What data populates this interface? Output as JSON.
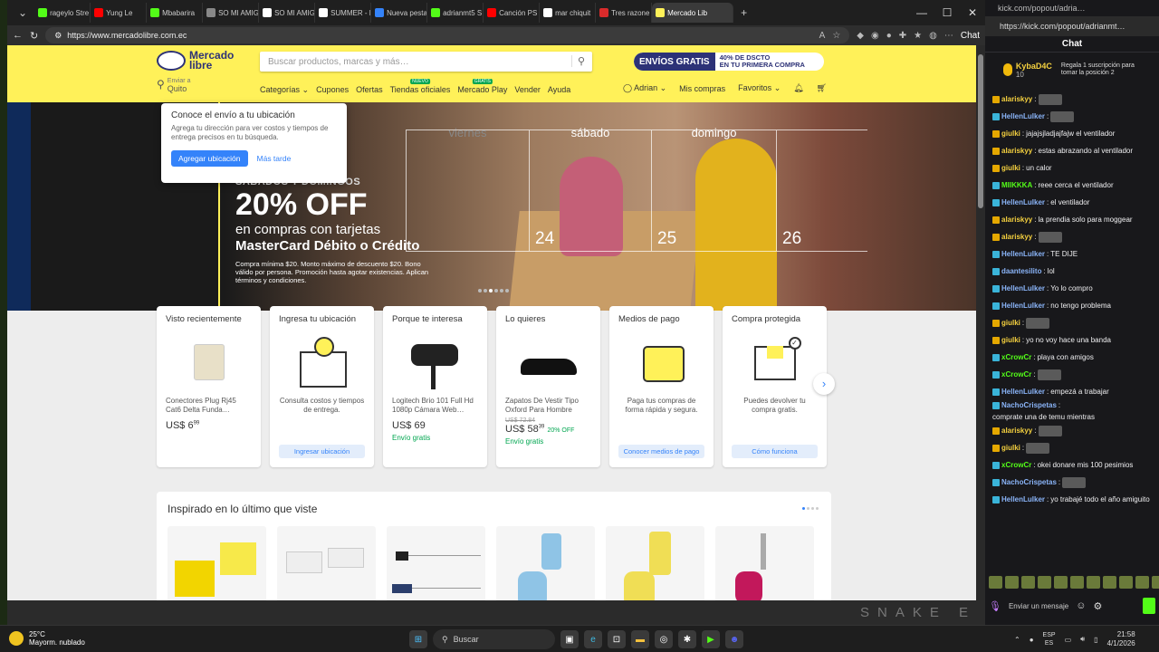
{
  "browser": {
    "tabs": [
      {
        "label": "rageylo Stre",
        "color": "#53fc18"
      },
      {
        "label": "Yung Le",
        "color": "#ff0000"
      },
      {
        "label": "Mbabarira",
        "color": "#53fc18"
      },
      {
        "label": "SO MI AMIG",
        "color": "#888888"
      },
      {
        "label": "SO MI AMIG",
        "color": "#ffffff"
      },
      {
        "label": "SUMMER - L",
        "color": "#ffffff"
      },
      {
        "label": "Nueva pesta",
        "color": "#3483fa"
      },
      {
        "label": "adrianmt5 S",
        "color": "#53fc18"
      },
      {
        "label": "Canción PS",
        "color": "#ff0000"
      },
      {
        "label": "mar chiquit",
        "color": "#ffffff"
      },
      {
        "label": "Tres razone",
        "color": "#d92b2b"
      },
      {
        "label": "Mercado Lib",
        "color": "#fff159"
      }
    ],
    "url": "https://www.mercadolibre.com.ec"
  },
  "ml": {
    "logo_line1": "Mercado",
    "logo_line2": "libre",
    "search_placeholder": "Buscar productos, marcas y más…",
    "promo_a": "ENVÍOS GRATIS",
    "promo_b1": "40% DE DSCTO",
    "promo_b2": "EN TU PRIMERA COMPRA",
    "loc_l1": "Enviar a",
    "loc_l2": "Quito",
    "nav": [
      "Categorías",
      "Cupones",
      "Ofertas",
      "Tiendas oficiales",
      "Mercado Play",
      "Vender",
      "Ayuda"
    ],
    "nav_badge_nuevo": "NUEVO",
    "nav_badge_gratis": "GRATIS",
    "user": "Adrian",
    "mis_compras": "Mis compras",
    "favoritos": "Favoritos"
  },
  "popup": {
    "title": "Conoce el envío a tu ubicación",
    "desc": "Agrega tu dirección para ver costos y tiempos de entrega precisos en tu búsqueda.",
    "primary": "Agregar ubicación",
    "secondary": "Más tarde"
  },
  "hero": {
    "kicker": "SÁBADOS Y DOMINGOS",
    "big": "20% OFF",
    "sub1": "en compras con tarjetas",
    "sub2": "MasterCard Débito o Crédito",
    "fine": "Compra mínima $20. Monto máximo de descuento $20. Bono válido por persona. Promoción hasta agotar existencias. Aplican términos y condiciones.",
    "days": [
      "viernes",
      "sábado",
      "domingo"
    ],
    "nums": [
      "24",
      "25",
      "26"
    ]
  },
  "cards": [
    {
      "h": "Visto recientemente",
      "desc": "Conectores Plug Rj45 Cat6 Delta Funda…",
      "price": "US$ 6",
      "cents": "99"
    },
    {
      "h": "Ingresa tu ubicación",
      "desc": "Consulta costos y tiempos de entrega.",
      "cta": "Ingresar ubicación"
    },
    {
      "h": "Porque te interesa",
      "desc": "Logitech Brio 101 Full Hd 1080p Cámara Web…",
      "price": "US$ 69",
      "ship": "Envío gratis"
    },
    {
      "h": "Lo quieres",
      "desc": "Zapatos De Vestir Tipo Oxford Para Hombre",
      "old": "US$ 72.84",
      "price": "US$ 58",
      "cents": "39",
      "off": "20% OFF",
      "ship": "Envío gratis"
    },
    {
      "h": "Medios de pago",
      "desc": "Paga tus compras de forma rápida y segura.",
      "cta": "Conocer medios de pago"
    },
    {
      "h": "Compra protegida",
      "desc": "Puedes devolver tu compra gratis.",
      "cta": "Cómo funciona"
    }
  ],
  "inspired": {
    "title": "Inspirado en lo último que viste"
  },
  "chat": {
    "url_top": "kick.com/popout/adria…",
    "url": "https://kick.com/popout/adrianmt…",
    "header": "Chat",
    "pinned_user": "KybaD4C",
    "pinned_count": "10",
    "pinned_msg": "Regala 1 suscripción para tomar la posición 2",
    "messages": [
      {
        "u": "alariskyy",
        "c": "#f4d03f",
        "t": ""
      },
      {
        "u": "HellenLulker",
        "c": "#8ab4f8",
        "t": ""
      },
      {
        "u": "giulki",
        "c": "#f4d03f",
        "t": "jajajsjladjajfajw el ventilador"
      },
      {
        "u": "alariskyy",
        "c": "#f4d03f",
        "t": "estas abrazando al ventilador"
      },
      {
        "u": "giulki",
        "c": "#f4d03f",
        "t": "un calor"
      },
      {
        "u": "MIIKKKA",
        "c": "#53fc18",
        "t": "reee cerca el ventilador"
      },
      {
        "u": "HellenLulker",
        "c": "#8ab4f8",
        "t": "el ventilador"
      },
      {
        "u": "alariskyy",
        "c": "#f4d03f",
        "t": "la prendia solo para moggear"
      },
      {
        "u": "alariskyy",
        "c": "#f4d03f",
        "t": ""
      },
      {
        "u": "HellenLulker",
        "c": "#8ab4f8",
        "t": "TE DIJE"
      },
      {
        "u": "daantesilito",
        "c": "#8ab4f8",
        "t": "lol"
      },
      {
        "u": "HellenLulker",
        "c": "#8ab4f8",
        "t": "Yo lo compro"
      },
      {
        "u": "HellenLulker",
        "c": "#8ab4f8",
        "t": "no tengo problema"
      },
      {
        "u": "giulki",
        "c": "#f4d03f",
        "t": ""
      },
      {
        "u": "giulki",
        "c": "#f4d03f",
        "t": "yo no voy hace una banda"
      },
      {
        "u": "xCrowCr",
        "c": "#53fc18",
        "t": "playa con amigos"
      },
      {
        "u": "xCrowCr",
        "c": "#53fc18",
        "t": ""
      },
      {
        "u": "HellenLulker",
        "c": "#8ab4f8",
        "t": "empezá a trabajar"
      },
      {
        "u": "NachoCrispetas",
        "c": "#8ab4f8",
        "t": "comprate una de temu mientras"
      },
      {
        "u": "alariskyy",
        "c": "#f4d03f",
        "t": ""
      },
      {
        "u": "giulki",
        "c": "#f4d03f",
        "t": ""
      },
      {
        "u": "xCrowCr",
        "c": "#53fc18",
        "t": "okei donare mis 100 pesimios"
      },
      {
        "u": "NachoCrispetas",
        "c": "#8ab4f8",
        "t": ""
      },
      {
        "u": "HellenLulker",
        "c": "#8ab4f8",
        "t": "yo trabajé todo el año amiguito"
      }
    ],
    "send_label": "Enviar un mensaje"
  },
  "overlay_text": "SNAKE E",
  "taskbar": {
    "temp": "25°C",
    "weather": "Mayorm. nublado",
    "search": "Buscar",
    "lang1": "ESP",
    "lang2": "ES",
    "time": "21:58",
    "date": "4/1/2026"
  }
}
